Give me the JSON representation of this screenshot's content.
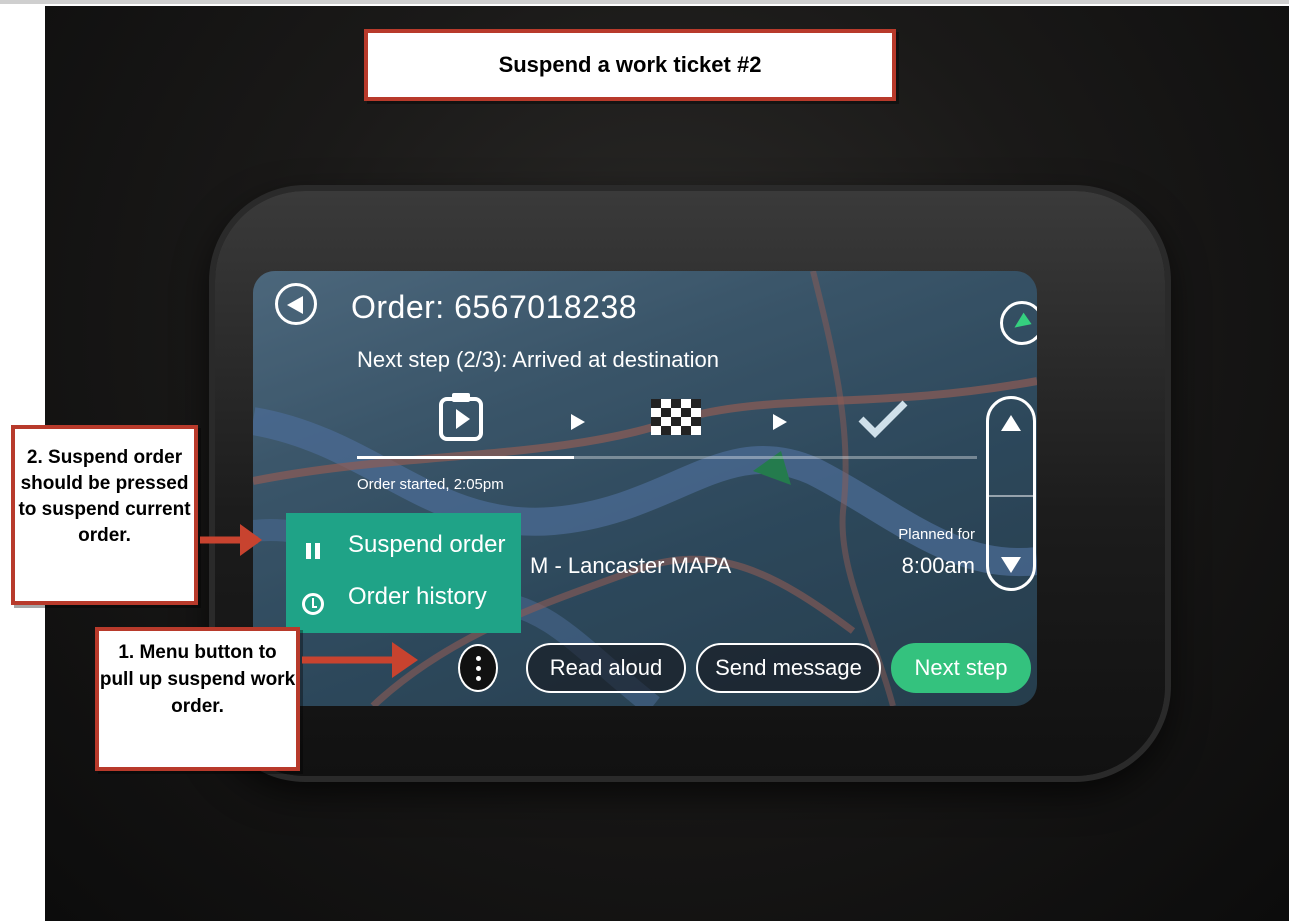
{
  "annotation": {
    "title": "Suspend a work ticket #2",
    "callout_suspend": "2. Suspend order should be pressed to suspend current  order.",
    "callout_menu": "1. Menu button to pull up suspend work order."
  },
  "device_screen": {
    "order_title": "Order: 6567018238",
    "next_step": "Next step (2/3): Arrived at destination",
    "order_started": "Order started, 2:05pm",
    "destination": "M  - Lancaster MAPA",
    "planned_label": "Planned for",
    "planned_time": "8:00am",
    "progress_fraction": 0.35,
    "menu": {
      "suspend_order": "Suspend order",
      "order_history": "Order history"
    },
    "buttons": {
      "read_aloud": "Read aloud",
      "send_message": "Send message",
      "next_step": "Next step"
    },
    "icons": [
      "back-arrow-icon",
      "navigate-icon",
      "clipboard-play-icon",
      "checkered-flag-icon",
      "checkmark-icon",
      "pause-icon",
      "clock-history-icon",
      "kebab-menu-icon",
      "scroll-up-icon",
      "scroll-down-icon"
    ]
  },
  "colors": {
    "callout_border": "#b83a2b",
    "menu_green": "#1fa387",
    "next_step_green": "#34c27e"
  }
}
